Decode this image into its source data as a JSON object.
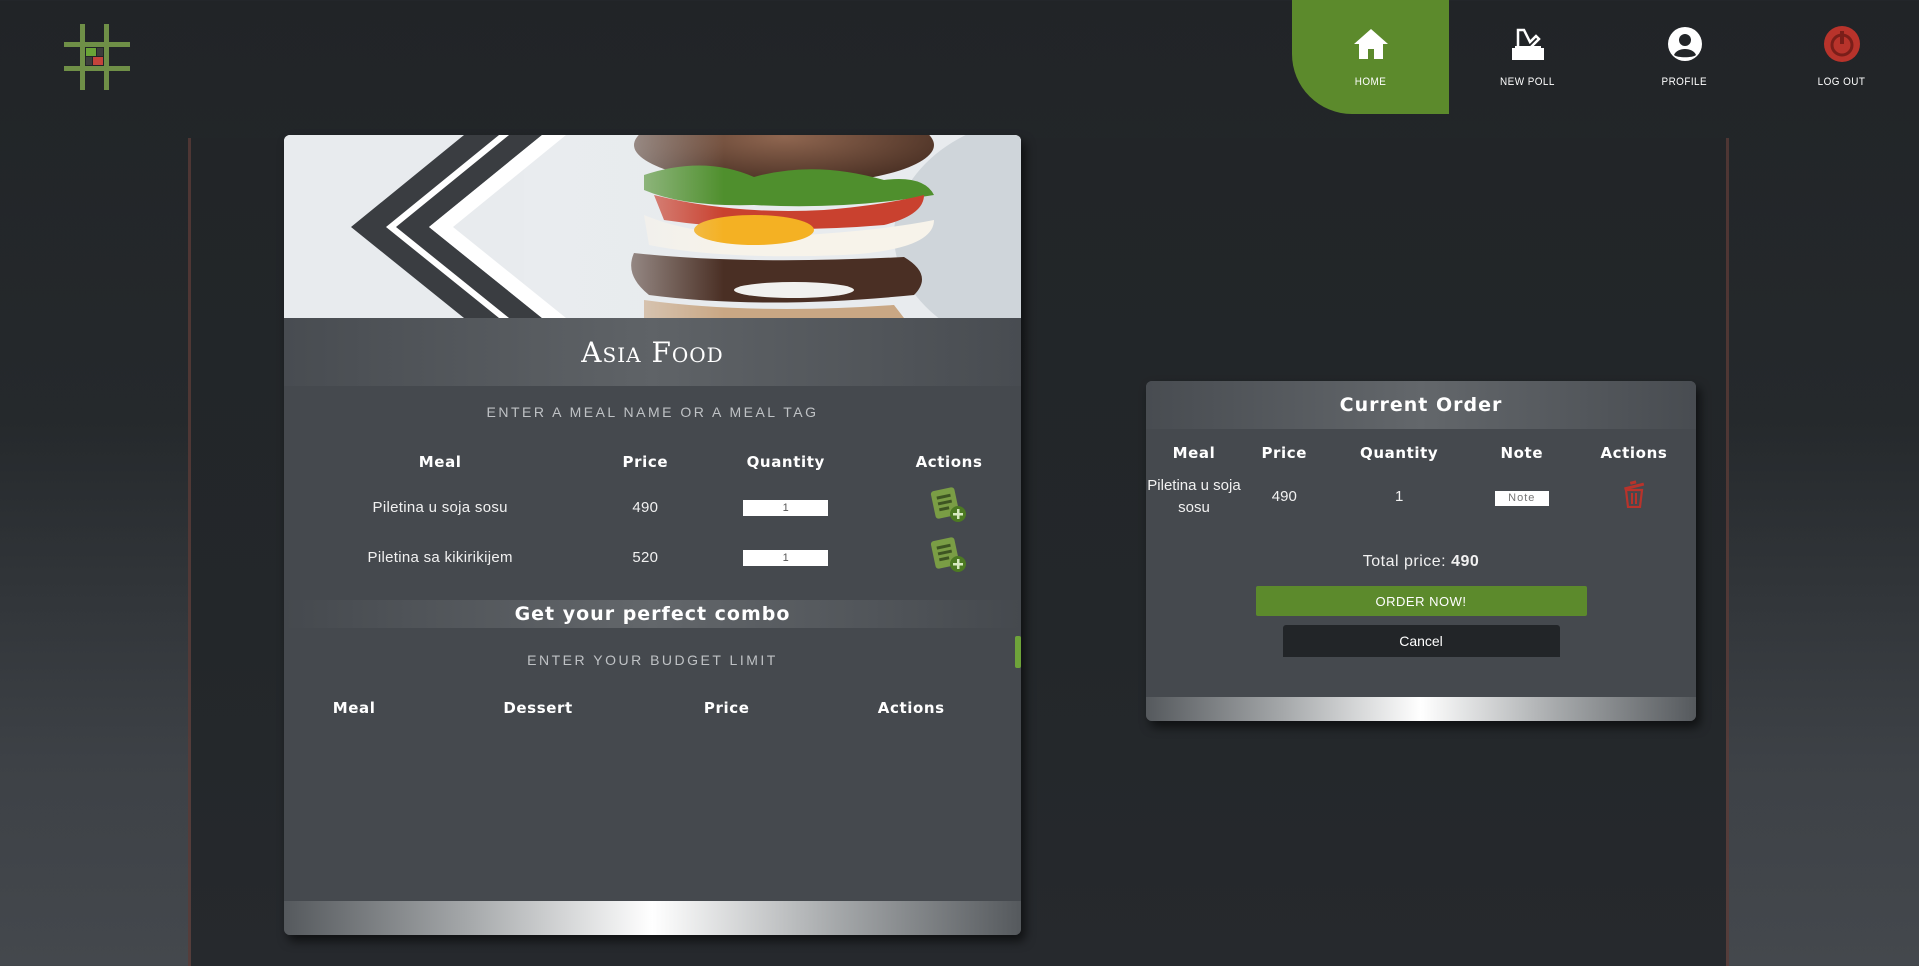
{
  "nav": {
    "items": [
      {
        "label": "HOME",
        "icon": "home-icon",
        "active": true
      },
      {
        "label": "NEW POLL",
        "icon": "new-poll-icon",
        "active": false
      },
      {
        "label": "PROFILE",
        "icon": "profile-icon",
        "active": false
      },
      {
        "label": "LOG OUT",
        "icon": "power-icon",
        "active": false
      }
    ]
  },
  "colors": {
    "accent": "#5c8a2c",
    "danger": "#b8332b",
    "card": "#45494e",
    "background": "#222528"
  },
  "restaurant": {
    "title": "Asia Food",
    "search_placeholder": "ENTER A MEAL NAME OR A MEAL TAG",
    "columns": [
      "Meal",
      "Price",
      "Quantity",
      "Actions"
    ],
    "meals": [
      {
        "name": "Piletina u soja sosu",
        "price": "490",
        "quantity": "1"
      },
      {
        "name": "Piletina sa kikirikijem",
        "price": "520",
        "quantity": "1"
      }
    ]
  },
  "combo": {
    "title": "Get your perfect combo",
    "budget_placeholder": "ENTER YOUR BUDGET LIMIT",
    "columns": [
      "Meal",
      "Dessert",
      "Price",
      "Actions"
    ]
  },
  "order": {
    "title": "Current Order",
    "columns": [
      "Meal",
      "Price",
      "Quantity",
      "Note",
      "Actions"
    ],
    "rows": [
      {
        "meal": "Piletina u soja sosu",
        "price": "490",
        "quantity": "1",
        "note_placeholder": "Note"
      }
    ],
    "total_label": "Total price:",
    "total_value": "490",
    "order_button": "ORDER NOW!",
    "cancel_button": "Cancel"
  }
}
